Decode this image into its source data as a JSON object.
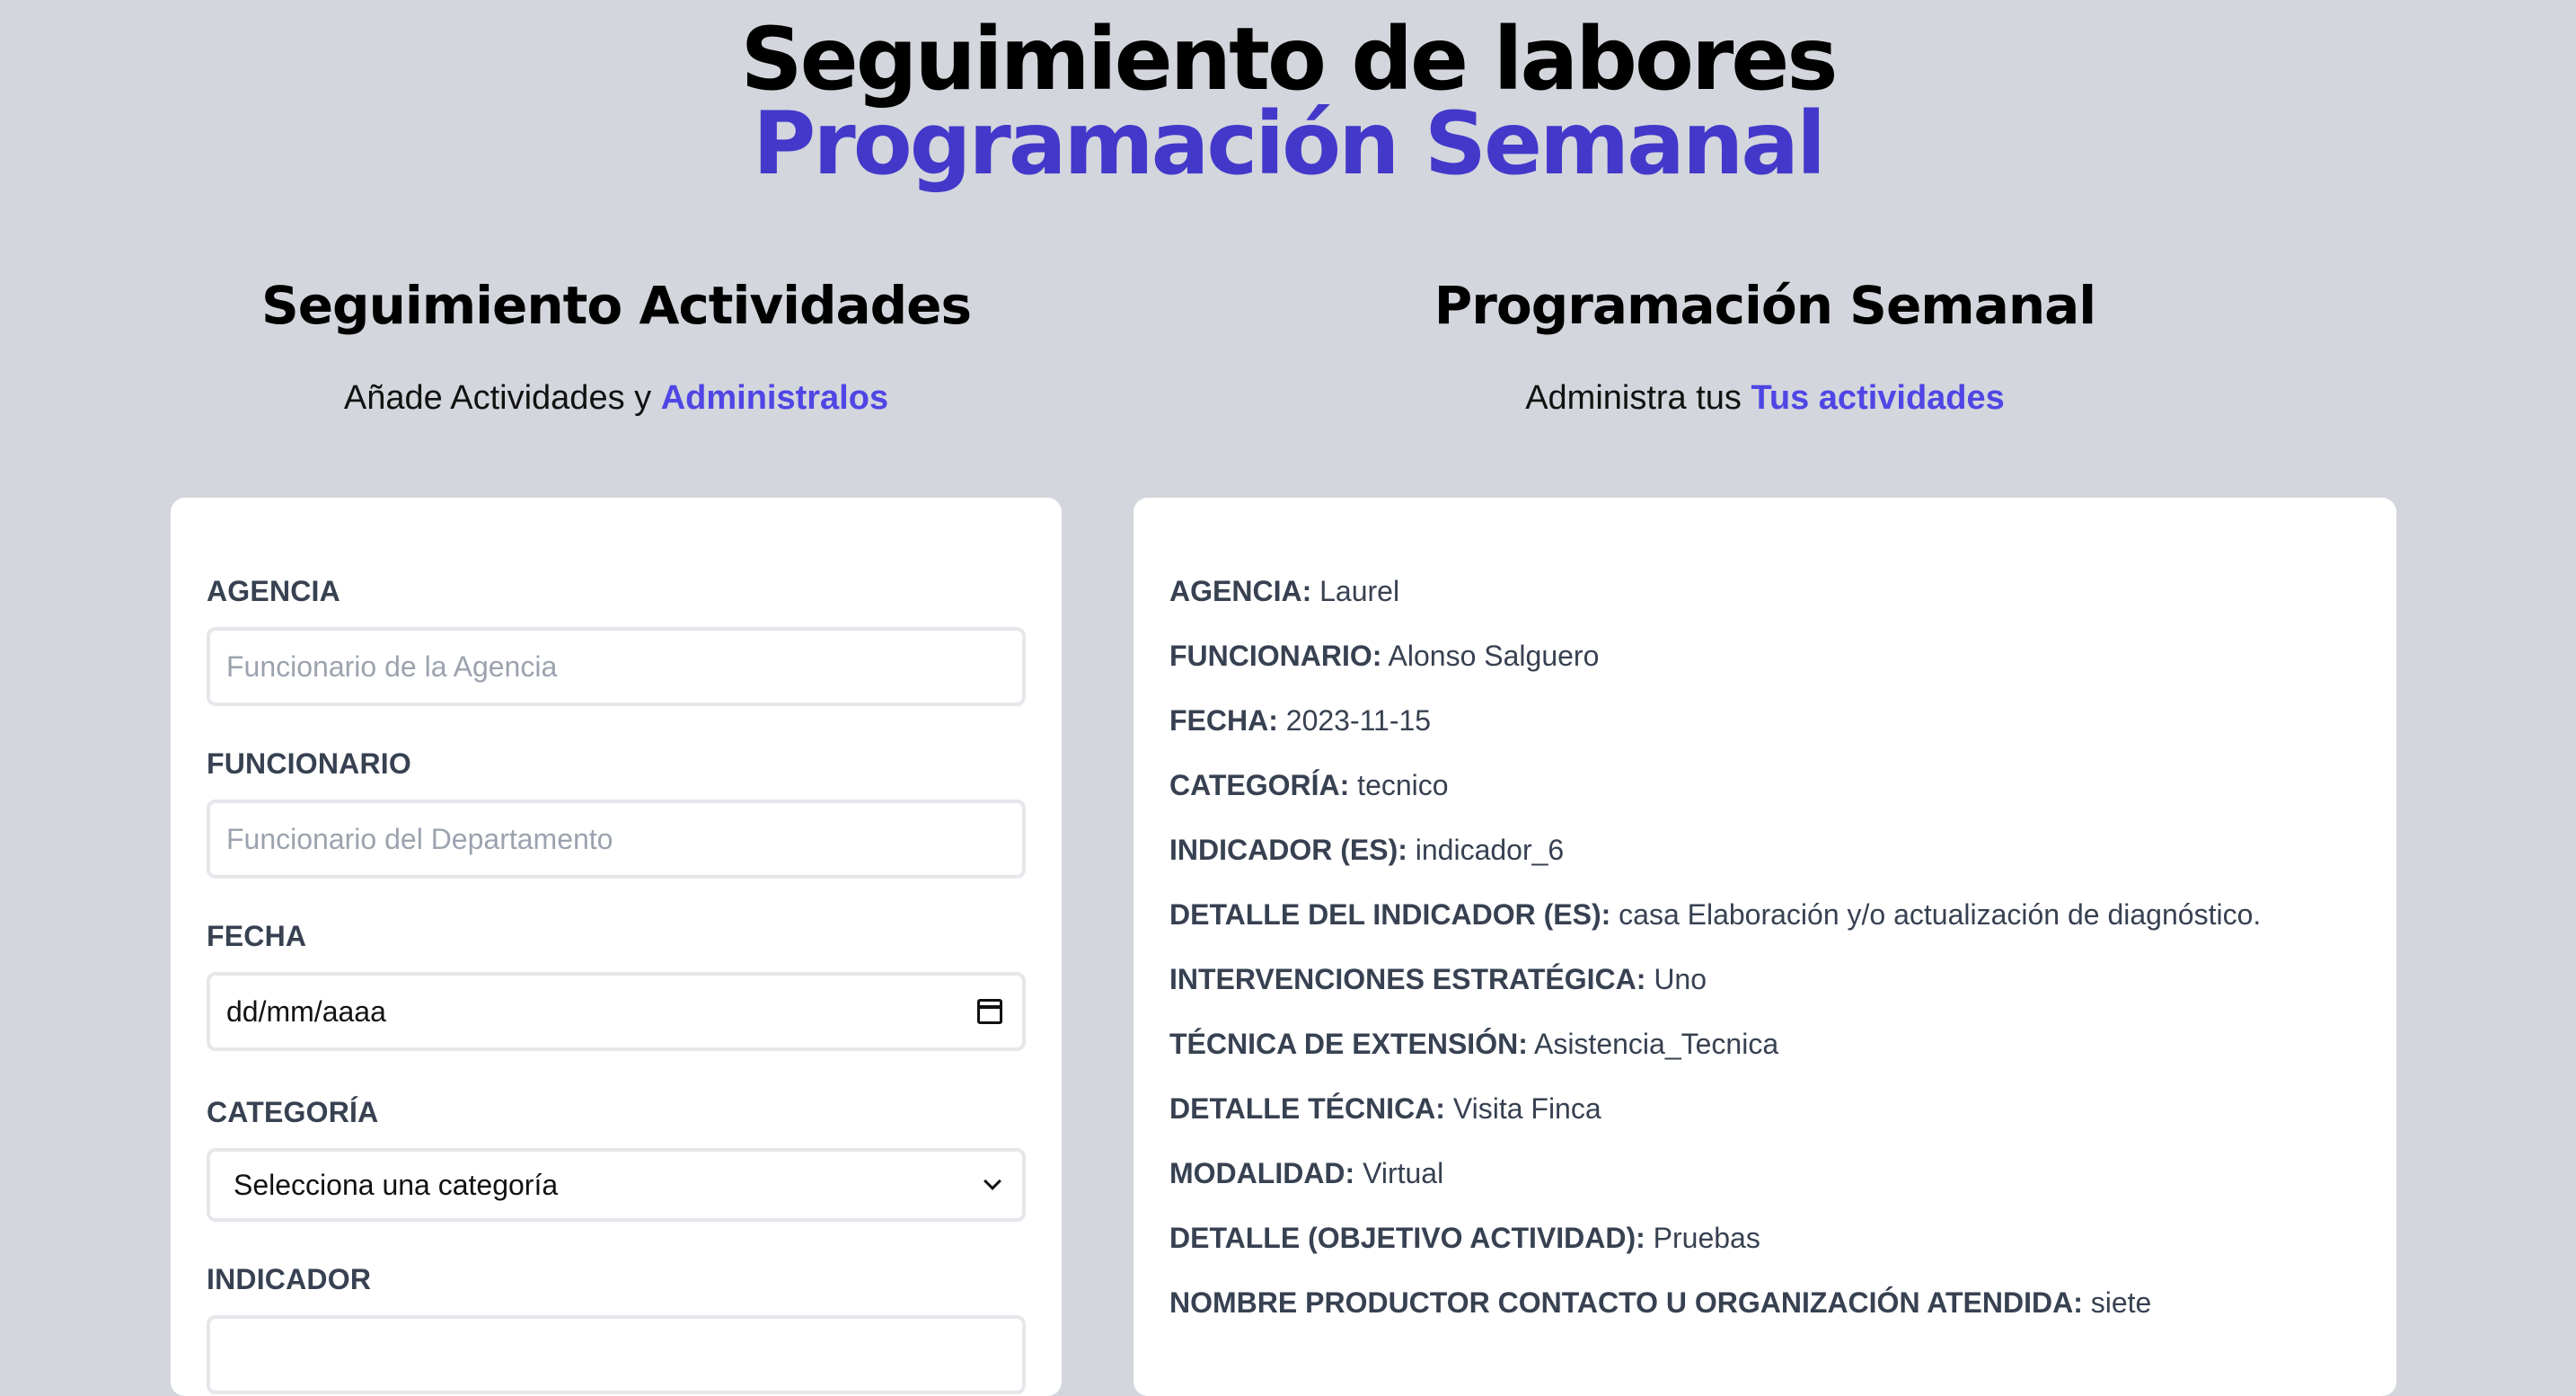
{
  "header": {
    "title": "Seguimiento de labores",
    "subtitle": "Programación Semanal"
  },
  "left": {
    "title": "Seguimiento Actividades",
    "subtitle_prefix": "Añade Actividades y",
    "subtitle_accent": "Administralos",
    "form": {
      "agencia_label": "AGENCIA",
      "agencia_placeholder": "Funcionario de la Agencia",
      "funcionario_label": "FUNCIONARIO",
      "funcionario_placeholder": "Funcionario del Departamento",
      "fecha_label": "FECHA",
      "fecha_value": "dd/mm/aaaa",
      "fecha_icon": "calendar-icon",
      "categoria_label": "CATEGORÍA",
      "categoria_value": "Selecciona una categoría",
      "categoria_icon": "chevron-down-icon",
      "indicador_label": "INDICADOR"
    }
  },
  "right": {
    "title": "Programación Semanal",
    "subtitle_prefix": "Administra tus",
    "subtitle_accent": "Tus actividades",
    "details": [
      {
        "label": "AGENCIA:",
        "value": "Laurel"
      },
      {
        "label": "FUNCIONARIO:",
        "value": "Alonso Salguero"
      },
      {
        "label": "FECHA:",
        "value": "2023-11-15"
      },
      {
        "label": "CATEGORÍA:",
        "value": "tecnico"
      },
      {
        "label": "INDICADOR (ES):",
        "value": "indicador_6"
      },
      {
        "label": "DETALLE DEL INDICADOR (ES):",
        "value": "casa Elaboración y/o actualización de diagnóstico."
      },
      {
        "label": "INTERVENCIONES ESTRATÉGICA:",
        "value": "Uno"
      },
      {
        "label": "TÉCNICA DE EXTENSIÓN:",
        "value": "Asistencia_Tecnica"
      },
      {
        "label": "DETALLE TÉCNICA:",
        "value": "Visita Finca"
      },
      {
        "label": "MODALIDAD:",
        "value": "Virtual"
      },
      {
        "label": "DETALLE (OBJETIVO ACTIVIDAD):",
        "value": "Pruebas"
      },
      {
        "label": "NOMBRE PRODUCTOR CONTACTO U ORGANIZACIÓN ATENDIDA:",
        "value": "siete"
      }
    ]
  },
  "colors": {
    "accent": "#4338ca",
    "link": "#4f46e5",
    "background": "#d3d6dc",
    "card": "#ffffff"
  }
}
